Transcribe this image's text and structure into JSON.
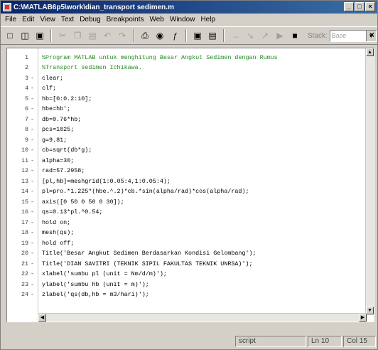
{
  "window": {
    "title": "C:\\MATLAB6p5\\work\\dian_transport sedimen.m",
    "minimize": "_",
    "maximize": "□",
    "close": "×"
  },
  "menu": [
    "File",
    "Edit",
    "View",
    "Text",
    "Debug",
    "Breakpoints",
    "Web",
    "Window",
    "Help"
  ],
  "toolbar": {
    "stack_label": "Stack:",
    "stack_value": "Base",
    "buttons": [
      "new",
      "open",
      "save",
      "cut",
      "copy",
      "paste",
      "undo",
      "redo",
      "print",
      "find",
      "function",
      "run",
      "step",
      "clear",
      "stop",
      "step-in",
      "step-out",
      "continue"
    ]
  },
  "editor": {
    "lines": [
      {
        "n": "1",
        "dash": "",
        "text": "%Program MATLAB untuk menghitung Besar Angkut Sedimen dengan Rumus",
        "comment": true
      },
      {
        "n": "2",
        "dash": "",
        "text": "%Transport sedimen Ichikawa.",
        "comment": true
      },
      {
        "n": "3",
        "dash": "-",
        "text": "clear;",
        "comment": false
      },
      {
        "n": "4",
        "dash": "-",
        "text": "clf;",
        "comment": false
      },
      {
        "n": "5",
        "dash": "-",
        "text": "hb=[0:0.2:10];",
        "comment": false
      },
      {
        "n": "6",
        "dash": "-",
        "text": "hbe=hb';",
        "comment": false
      },
      {
        "n": "7",
        "dash": "-",
        "text": "db=0.76*hb;",
        "comment": false
      },
      {
        "n": "8",
        "dash": "-",
        "text": "pcs=1025;",
        "comment": false
      },
      {
        "n": "9",
        "dash": "-",
        "text": "g=9.81;",
        "comment": false
      },
      {
        "n": "10",
        "dash": "-",
        "text": "cb=sqrt(db*g);",
        "comment": false
      },
      {
        "n": "11",
        "dash": "-",
        "text": "alpha=30;",
        "comment": false
      },
      {
        "n": "12",
        "dash": "-",
        "text": "rad=57.2958;",
        "comment": false
      },
      {
        "n": "13",
        "dash": "-",
        "text": "[pl,hb]=meshgrid(1:0.05:4,1:0.05:4);",
        "comment": false
      },
      {
        "n": "14",
        "dash": "-",
        "text": "pl=pro.*1.225*(hbe.^.2)*cb.*sin(alpha/rad)*cos(alpha/rad);",
        "comment": false
      },
      {
        "n": "15",
        "dash": "-",
        "text": "axis([0 50 0 50 0 30]);",
        "comment": false
      },
      {
        "n": "16",
        "dash": "-",
        "text": "qs=0.13*pl.^0.54;",
        "comment": false
      },
      {
        "n": "17",
        "dash": "-",
        "text": "hold on;",
        "comment": false
      },
      {
        "n": "18",
        "dash": "-",
        "text": "mesh(qs);",
        "comment": false
      },
      {
        "n": "19",
        "dash": "-",
        "text": "hold off;",
        "comment": false
      },
      {
        "n": "20",
        "dash": "-",
        "text": "Title('Besar Angkut Sedimen Berdasarkan Kondisi Gelombang');",
        "comment": false
      },
      {
        "n": "21",
        "dash": "-",
        "text": "Title('DIAN SAVITRI (TEKNIK SIPIL FAKULTAS TEKNIK UNRSA)');",
        "comment": false
      },
      {
        "n": "22",
        "dash": "-",
        "text": "xlabel('sumbu pl (unit = Nm/d/m)');",
        "comment": false
      },
      {
        "n": "23",
        "dash": "-",
        "text": "ylabel('sumbu hb (unit = m)');",
        "comment": false
      },
      {
        "n": "24",
        "dash": "-",
        "text": "zlabel('qs(db,hb = m3/hari)');",
        "comment": false
      }
    ]
  },
  "status": {
    "mode": "script",
    "line": "Ln 10",
    "col": "Col 15"
  }
}
